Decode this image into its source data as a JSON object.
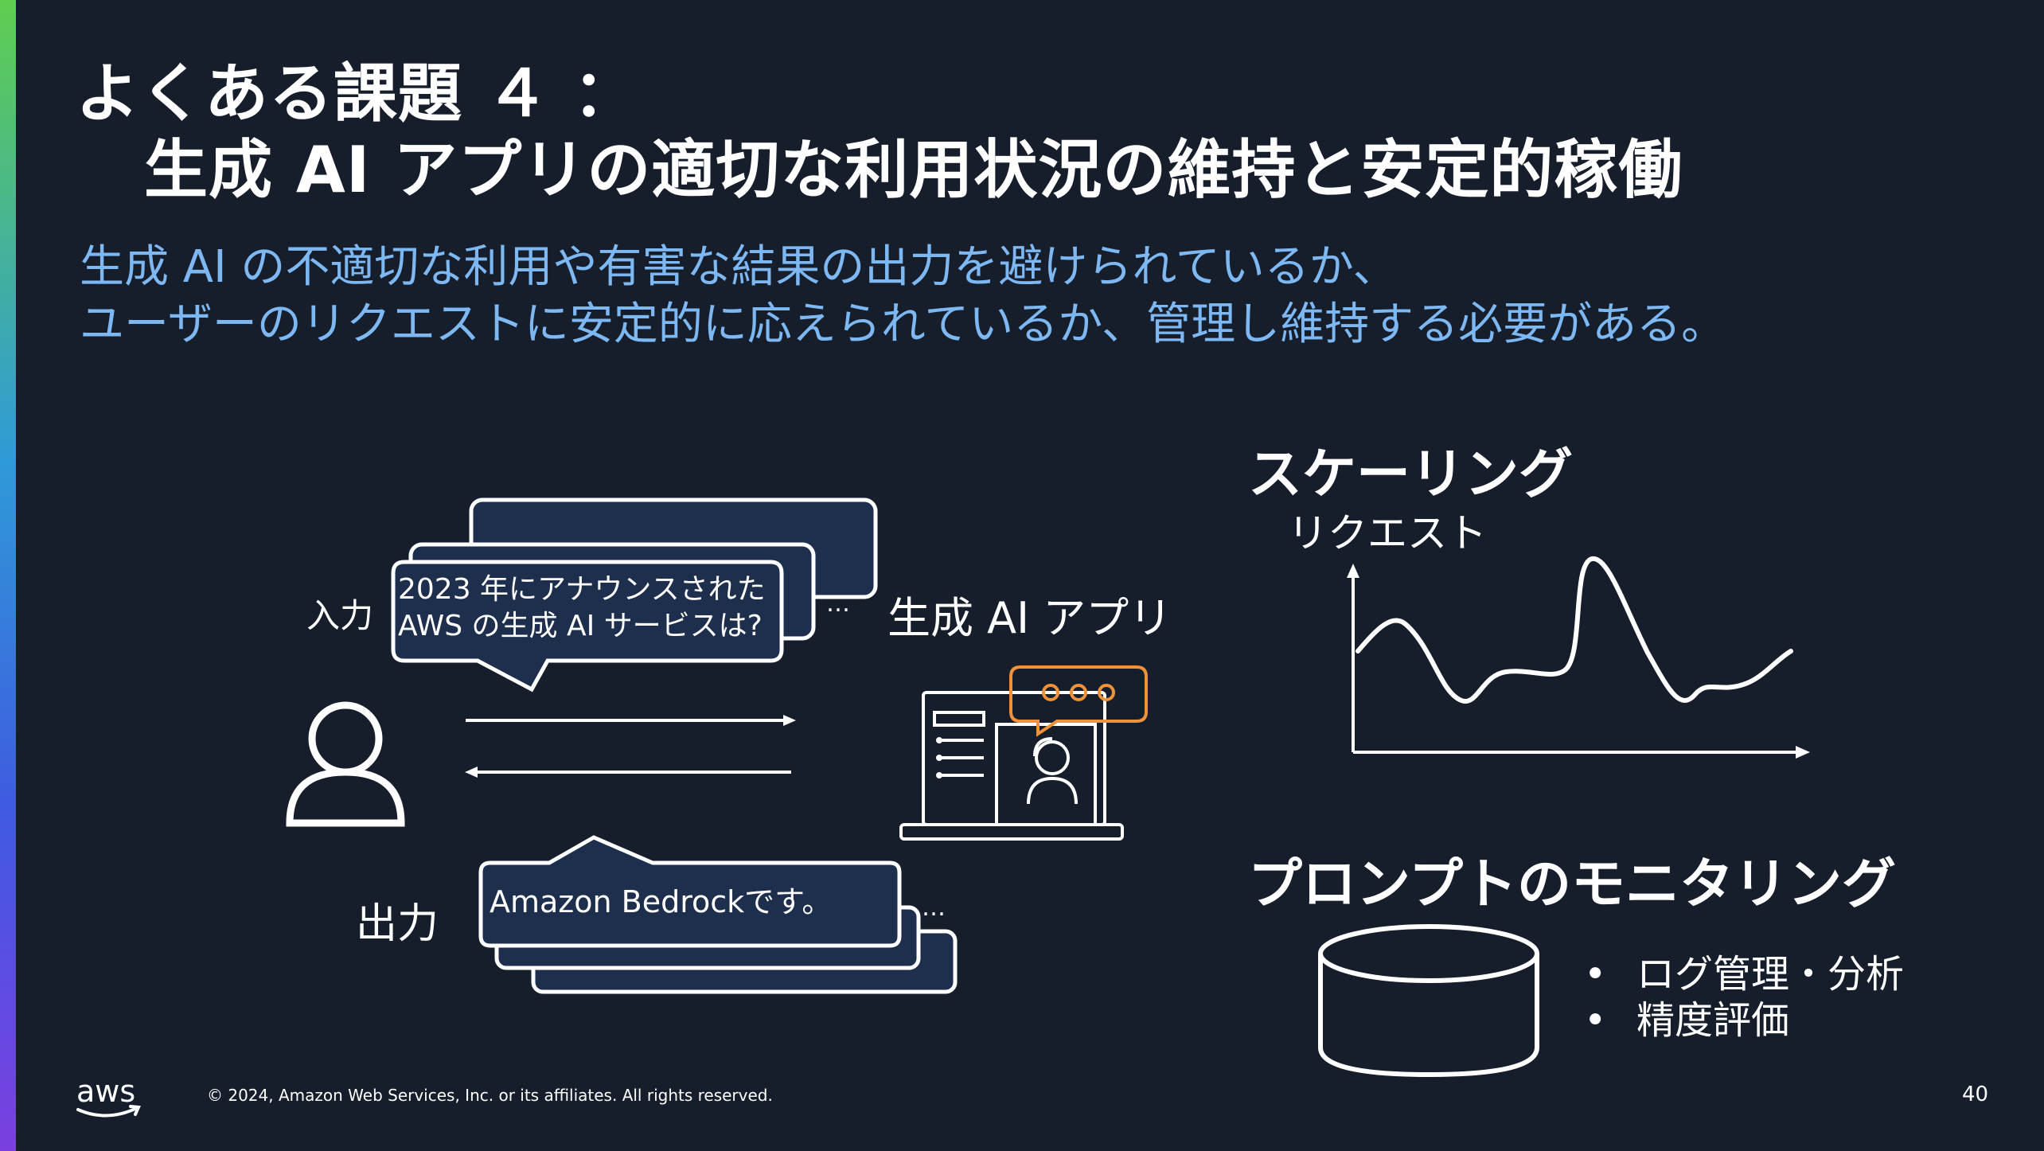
{
  "slide": {
    "title_line1": "よくある課題 ４ ：",
    "title_line2": "生成 AI アプリの適切な利用状況の維持と安定的稼働",
    "subtitle_line1": "生成 AI の不適切な利用や有害な結果の出力を避けられているか、",
    "subtitle_line2": "ユーザーのリクエストに安定的に応えられているか、管理し維持する必要がある。"
  },
  "diagram": {
    "input_label": "入力",
    "output_label": "出力",
    "app_label": "生成 AI アプリ",
    "question_line1": "2023 年にアナウンスされた",
    "question_line2": "AWS の生成 AI サービスは?",
    "answer": "Amazon Bedrockです。",
    "ellipsis": "…"
  },
  "scaling": {
    "heading": "スケーリング",
    "axis_label": "リクエスト"
  },
  "monitoring": {
    "heading": "プロンプトのモニタリング",
    "bullets": [
      "ログ管理・分析",
      "精度評価"
    ]
  },
  "footer": {
    "copyright": "© 2024, Amazon Web Services, Inc. or its affiliates. All rights reserved.",
    "page_number": "40",
    "logo_text": "aws"
  },
  "colors": {
    "background": "#161d2b",
    "subtitle": "#7eb8f2",
    "bubble_fill": "#1e2e4d",
    "chat_accent": "#f0923a"
  }
}
